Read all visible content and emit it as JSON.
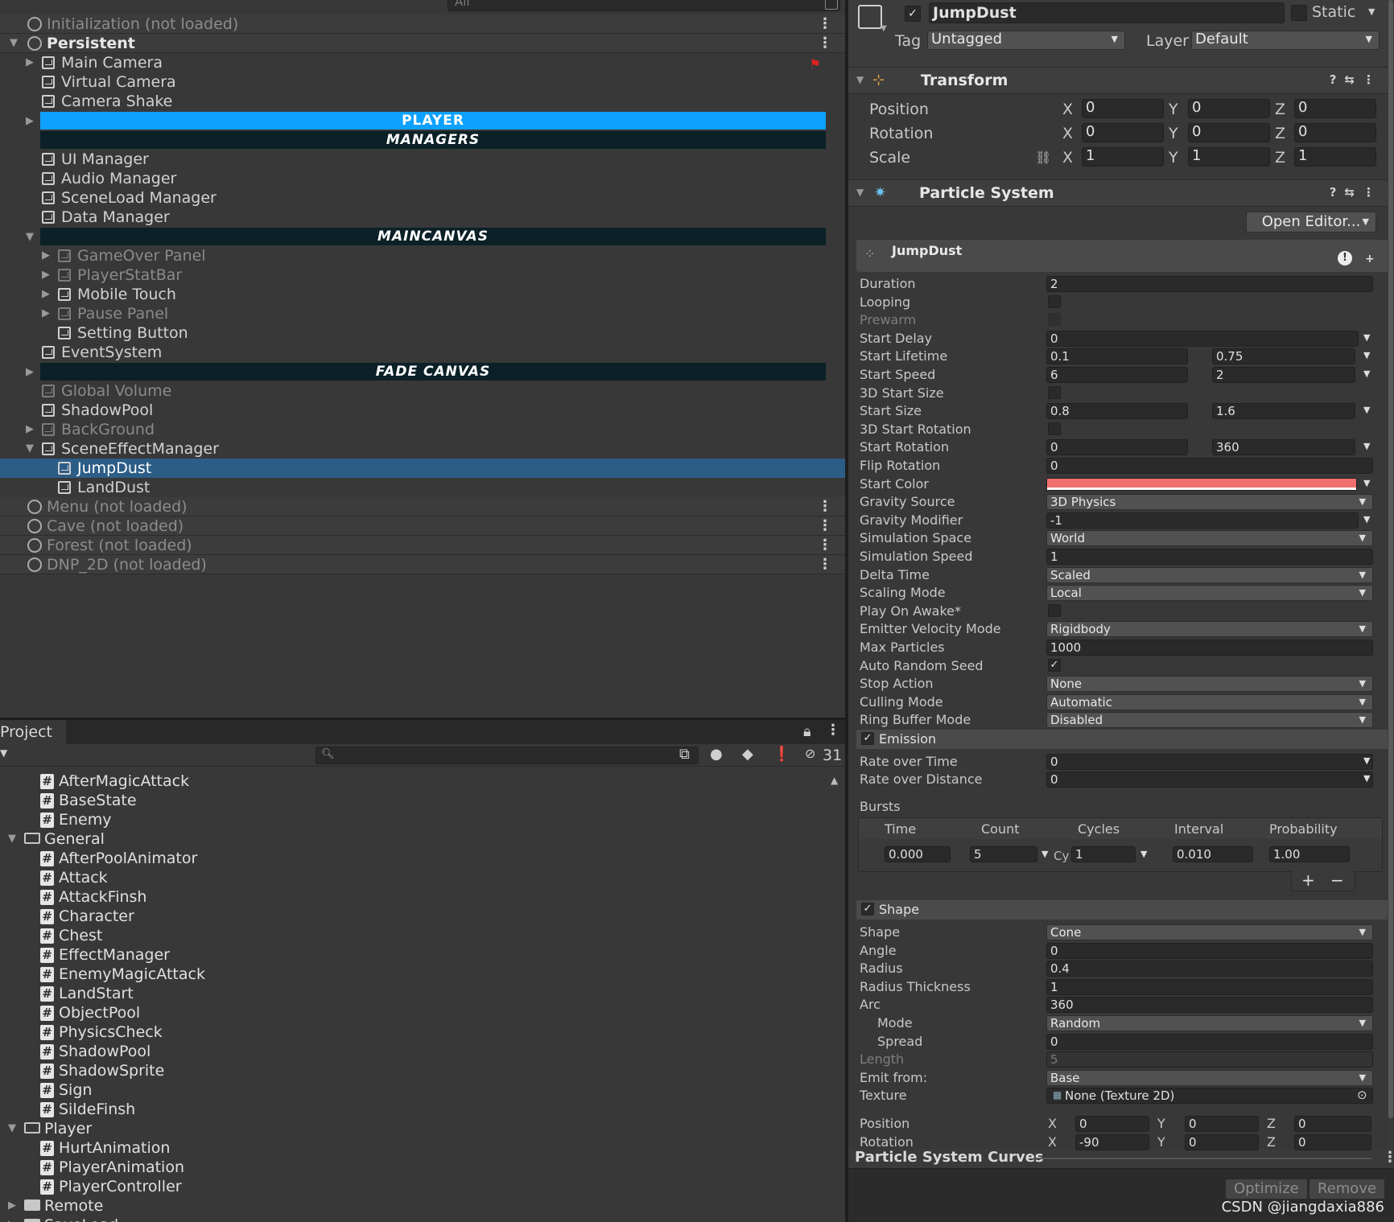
{
  "hierarchy": {
    "search_placeholder": "All",
    "rows": [
      {
        "label": "Initialization (not loaded)",
        "type": "scene",
        "dim": true
      },
      {
        "label": "Persistent",
        "type": "scene",
        "bold": true
      },
      {
        "label": "Main Camera",
        "indent": 1,
        "arrow": "right"
      },
      {
        "label": "Virtual Camera",
        "indent": 1
      },
      {
        "label": "Camera Shake",
        "indent": 1
      },
      {
        "label": "PLAYER",
        "type": "header",
        "style": "player"
      },
      {
        "label": "MANAGERS",
        "type": "header",
        "style": "dark"
      },
      {
        "label": "UI Manager",
        "indent": 1
      },
      {
        "label": "Audio Manager",
        "indent": 1
      },
      {
        "label": "SceneLoad Manager",
        "indent": 1
      },
      {
        "label": "Data Manager",
        "indent": 1
      },
      {
        "label": "MAINCANVAS",
        "type": "header",
        "style": "dark"
      },
      {
        "label": "GameOver Panel",
        "indent": 2,
        "arrow": "right",
        "dim": true
      },
      {
        "label": "PlayerStatBar",
        "indent": 2,
        "arrow": "right",
        "dim": true
      },
      {
        "label": "Mobile Touch",
        "indent": 2,
        "arrow": "right"
      },
      {
        "label": "Pause Panel",
        "indent": 2,
        "arrow": "right",
        "dim": true
      },
      {
        "label": "Setting Button",
        "indent": 2
      },
      {
        "label": "EventSystem",
        "indent": 1
      },
      {
        "label": "FADE CANVAS",
        "type": "header",
        "style": "dark"
      },
      {
        "label": "Global Volume",
        "indent": 1,
        "dim": true
      },
      {
        "label": "ShadowPool",
        "indent": 1
      },
      {
        "label": "BackGround",
        "indent": 1,
        "arrow": "right",
        "dim": true
      },
      {
        "label": "SceneEffectManager",
        "indent": 1,
        "arrow": "down"
      },
      {
        "label": "JumpDust",
        "indent": 2,
        "selected": true
      },
      {
        "label": "LandDust",
        "indent": 2
      },
      {
        "label": "Menu (not loaded)",
        "type": "scene",
        "dim": true
      },
      {
        "label": "Cave (not loaded)",
        "type": "scene",
        "dim": true
      },
      {
        "label": "Forest (not loaded)",
        "type": "scene",
        "dim": true
      },
      {
        "label": "DNP_2D (not loaded)",
        "type": "scene",
        "dim": true
      }
    ]
  },
  "project": {
    "tab_label": "Project",
    "hidden_count": "31",
    "items": [
      {
        "label": "AfterMagicAttack",
        "kind": "script",
        "indent": 1
      },
      {
        "label": "BaseState",
        "kind": "script",
        "indent": 1
      },
      {
        "label": "Enemy",
        "kind": "script",
        "indent": 1
      },
      {
        "label": "General",
        "kind": "folder-open",
        "indent": 0
      },
      {
        "label": "AfterPoolAnimator",
        "kind": "script",
        "indent": 1
      },
      {
        "label": "Attack",
        "kind": "script",
        "indent": 1
      },
      {
        "label": "AttackFinsh",
        "kind": "script",
        "indent": 1
      },
      {
        "label": "Character",
        "kind": "script",
        "indent": 1
      },
      {
        "label": "Chest",
        "kind": "script",
        "indent": 1
      },
      {
        "label": "EffectManager",
        "kind": "script",
        "indent": 1
      },
      {
        "label": "EnemyMagicAttack",
        "kind": "script",
        "indent": 1
      },
      {
        "label": "LandStart",
        "kind": "script",
        "indent": 1
      },
      {
        "label": "ObjectPool",
        "kind": "script",
        "indent": 1
      },
      {
        "label": "PhysicsCheck",
        "kind": "script",
        "indent": 1
      },
      {
        "label": "ShadowPool",
        "kind": "script",
        "indent": 1
      },
      {
        "label": "ShadowSprite",
        "kind": "script",
        "indent": 1
      },
      {
        "label": "Sign",
        "kind": "script",
        "indent": 1
      },
      {
        "label": "SildeFinsh",
        "kind": "script",
        "indent": 1
      },
      {
        "label": "Player",
        "kind": "folder-open",
        "indent": 0
      },
      {
        "label": "HurtAnimation",
        "kind": "script",
        "indent": 1
      },
      {
        "label": "PlayerAnimation",
        "kind": "script",
        "indent": 1
      },
      {
        "label": "PlayerController",
        "kind": "script",
        "indent": 1
      },
      {
        "label": "Remote",
        "kind": "folder",
        "indent": 0
      },
      {
        "label": "SaveLoad",
        "kind": "folder",
        "indent": 0
      }
    ]
  },
  "inspector": {
    "object_name": "JumpDust",
    "static_label": "Static",
    "tag_label": "Tag",
    "tag_value": "Untagged",
    "layer_label": "Layer",
    "layer_value": "Default",
    "transform": {
      "title": "Transform",
      "rows": [
        {
          "label": "Position",
          "x": "0",
          "y": "0",
          "z": "0"
        },
        {
          "label": "Rotation",
          "x": "0",
          "y": "0",
          "z": "0"
        },
        {
          "label": "Scale",
          "x": "1",
          "y": "1",
          "z": "1"
        }
      ]
    },
    "particle_system": {
      "title": "Particle System",
      "open_editor": "Open Editor...",
      "main_module": "JumpDust",
      "main_rows": [
        {
          "label": "Duration",
          "type": "field",
          "v1": "2"
        },
        {
          "label": "Looping",
          "type": "check",
          "checked": false
        },
        {
          "label": "Prewarm",
          "type": "check",
          "checked": false,
          "dim": true
        },
        {
          "label": "Start Delay",
          "type": "field-arrow",
          "v1": "0"
        },
        {
          "label": "Start Lifetime",
          "type": "range",
          "v1": "0.1",
          "v2": "0.75"
        },
        {
          "label": "Start Speed",
          "type": "range",
          "v1": "6",
          "v2": "2"
        },
        {
          "label": "3D Start Size",
          "type": "check",
          "checked": false
        },
        {
          "label": "Start Size",
          "type": "range",
          "v1": "0.8",
          "v2": "1.6"
        },
        {
          "label": "3D Start Rotation",
          "type": "check",
          "checked": false
        },
        {
          "label": "Start Rotation",
          "type": "range",
          "v1": "0",
          "v2": "360"
        },
        {
          "label": "Flip Rotation",
          "type": "field",
          "v1": "0"
        },
        {
          "label": "Start Color",
          "type": "color",
          "color": "#f07070"
        },
        {
          "label": "Gravity Source",
          "type": "drop",
          "v1": "3D Physics"
        },
        {
          "label": "Gravity Modifier",
          "type": "field-arrow",
          "v1": "-1"
        },
        {
          "label": "Simulation Space",
          "type": "drop",
          "v1": "World"
        },
        {
          "label": "Simulation Speed",
          "type": "field",
          "v1": "1"
        },
        {
          "label": "Delta Time",
          "type": "drop",
          "v1": "Scaled"
        },
        {
          "label": "Scaling Mode",
          "type": "drop",
          "v1": "Local"
        },
        {
          "label": "Play On Awake*",
          "type": "check",
          "checked": false
        },
        {
          "label": "Emitter Velocity Mode",
          "type": "drop",
          "v1": "Rigidbody"
        },
        {
          "label": "Max Particles",
          "type": "field",
          "v1": "1000"
        },
        {
          "label": "Auto Random Seed",
          "type": "check",
          "checked": true
        },
        {
          "label": "Stop Action",
          "type": "drop",
          "v1": "None"
        },
        {
          "label": "Culling Mode",
          "type": "drop",
          "v1": "Automatic"
        },
        {
          "label": "Ring Buffer Mode",
          "type": "drop",
          "v1": "Disabled"
        }
      ],
      "emission": {
        "title": "Emission",
        "rate_over_time_label": "Rate over Time",
        "rate_over_time": "0",
        "rate_over_distance_label": "Rate over Distance",
        "rate_over_distance": "0",
        "bursts_label": "Bursts",
        "columns": [
          "Time",
          "Count",
          "Cycles",
          "Interval",
          "Probability"
        ],
        "burst": {
          "time": "0.000",
          "count": "5",
          "cycles_prefix": "Cy",
          "cycles": "1",
          "interval": "0.010",
          "probability": "1.00"
        }
      },
      "shape": {
        "title": "Shape",
        "rows": [
          {
            "label": "Shape",
            "type": "drop",
            "v1": "Cone"
          },
          {
            "label": "Angle",
            "type": "field",
            "v1": "0"
          },
          {
            "label": "Radius",
            "type": "field",
            "v1": "0.4"
          },
          {
            "label": "Radius Thickness",
            "type": "field",
            "v1": "1"
          },
          {
            "label": "Arc",
            "type": "field",
            "v1": "360"
          },
          {
            "label": "Mode",
            "type": "drop",
            "v1": "Random",
            "sub": true
          },
          {
            "label": "Spread",
            "type": "field",
            "v1": "0",
            "sub": true
          },
          {
            "label": "Length",
            "type": "field",
            "v1": "5",
            "dim": true
          },
          {
            "label": "Emit from:",
            "type": "drop",
            "v1": "Base"
          },
          {
            "label": "Texture",
            "type": "field",
            "v1": "None (Texture 2D)"
          }
        ],
        "position": {
          "label": "Position",
          "x": "0",
          "y": "0",
          "z": "0"
        },
        "rotation": {
          "label": "Rotation",
          "x": "-90",
          "y": "0",
          "z": "0"
        }
      }
    },
    "curves_title": "Particle System Curves",
    "optimize_label": "Optimize",
    "remove_label": "Remove",
    "watermark": "CSDN @jiangdaxia886"
  }
}
